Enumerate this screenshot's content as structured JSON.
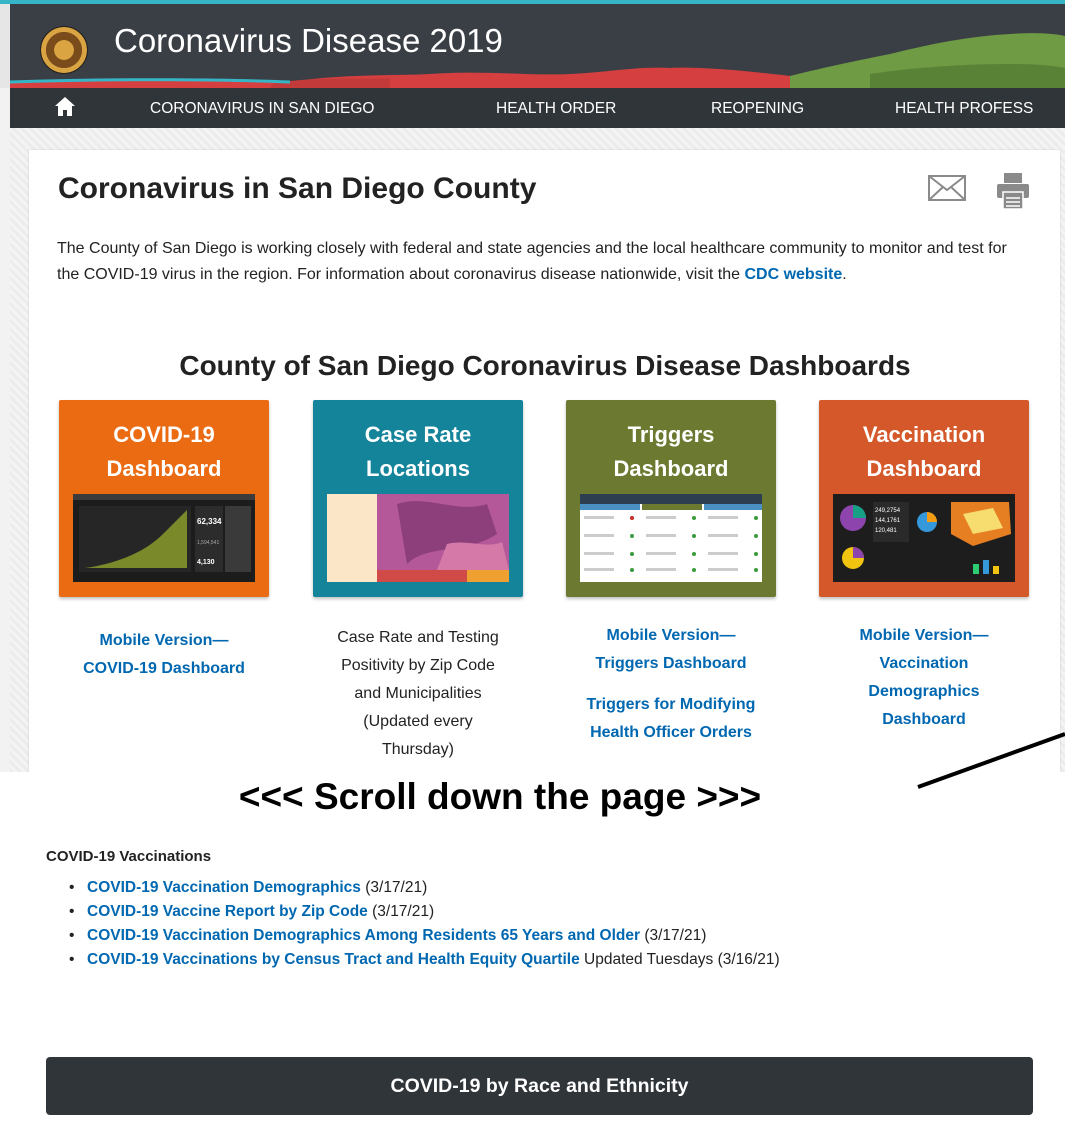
{
  "header": {
    "site_title": "Coronavirus Disease 2019",
    "icon": "county-seal-icon"
  },
  "nav": {
    "home_icon": "home-icon",
    "items": [
      {
        "label": "CORONAVIRUS IN SAN DIEGO"
      },
      {
        "label": "HEALTH ORDER"
      },
      {
        "label": "REOPENING"
      },
      {
        "label": "HEALTH PROFESS"
      }
    ]
  },
  "main": {
    "title": "Coronavirus in San Diego County",
    "intro_text": "The County of San Diego is working closely with federal and state agencies and the local healthcare community to monitor and test for the COVID-19 virus in the region. For information about coronavirus disease nationwide, visit the ",
    "intro_link": "CDC website",
    "intro_end": ".",
    "dashboards_heading": "County of San Diego Coronavirus Disease Dashboards",
    "tiles": [
      {
        "line1": "COVID-19",
        "line2": "Dashboard",
        "color": "#ea6b12"
      },
      {
        "line1": "Case Rate",
        "line2": "Locations",
        "color": "#14849a"
      },
      {
        "line1": "Triggers",
        "line2": "Dashboard",
        "color": "#6b7a30"
      },
      {
        "line1": "Vaccination",
        "line2": "Dashboard",
        "color": "#d5582a"
      }
    ],
    "captions": {
      "covid_mobile_1": "Mobile Version—",
      "covid_mobile_2": "COVID-19 Dashboard",
      "case_rate": [
        "Case Rate and Testing",
        "Positivity by Zip Code",
        "and Municipalities",
        "(Updated every",
        "Thursday)"
      ],
      "triggers_mobile_1": "Mobile Version—",
      "triggers_mobile_2": "Triggers Dashboard",
      "triggers_modify_1": "Triggers for Modifying",
      "triggers_modify_2": "Health Officer Orders",
      "vax_mobile": [
        "Mobile Version—",
        "Vaccination",
        "Demographics",
        "Dashboard"
      ]
    }
  },
  "scroll_banner": "<<< Scroll down the page >>>",
  "vaccinations": {
    "heading": "COVID-19 Vaccinations",
    "items": [
      {
        "link": "COVID-19 Vaccination Demographics",
        "suffix": " (3/17/21)"
      },
      {
        "link": "COVID-19 Vaccine Report by Zip Code",
        "suffix": " (3/17/21)"
      },
      {
        "link": "COVID-19 Vaccination Demographics Among Residents 65 Years and Older",
        "suffix": " (3/17/21)"
      },
      {
        "link": "COVID-19 Vaccinations by Census Tract and Health Equity Quartile",
        "suffix": " Updated Tuesdays (3/16/21)"
      }
    ],
    "race_button": "COVID-19 by Race and Ethnicity"
  },
  "colors": {
    "link": "#0067b1",
    "header_bg": "#3a3f45",
    "nav_bg": "#30353a",
    "accent_teal": "#36b5c6"
  }
}
